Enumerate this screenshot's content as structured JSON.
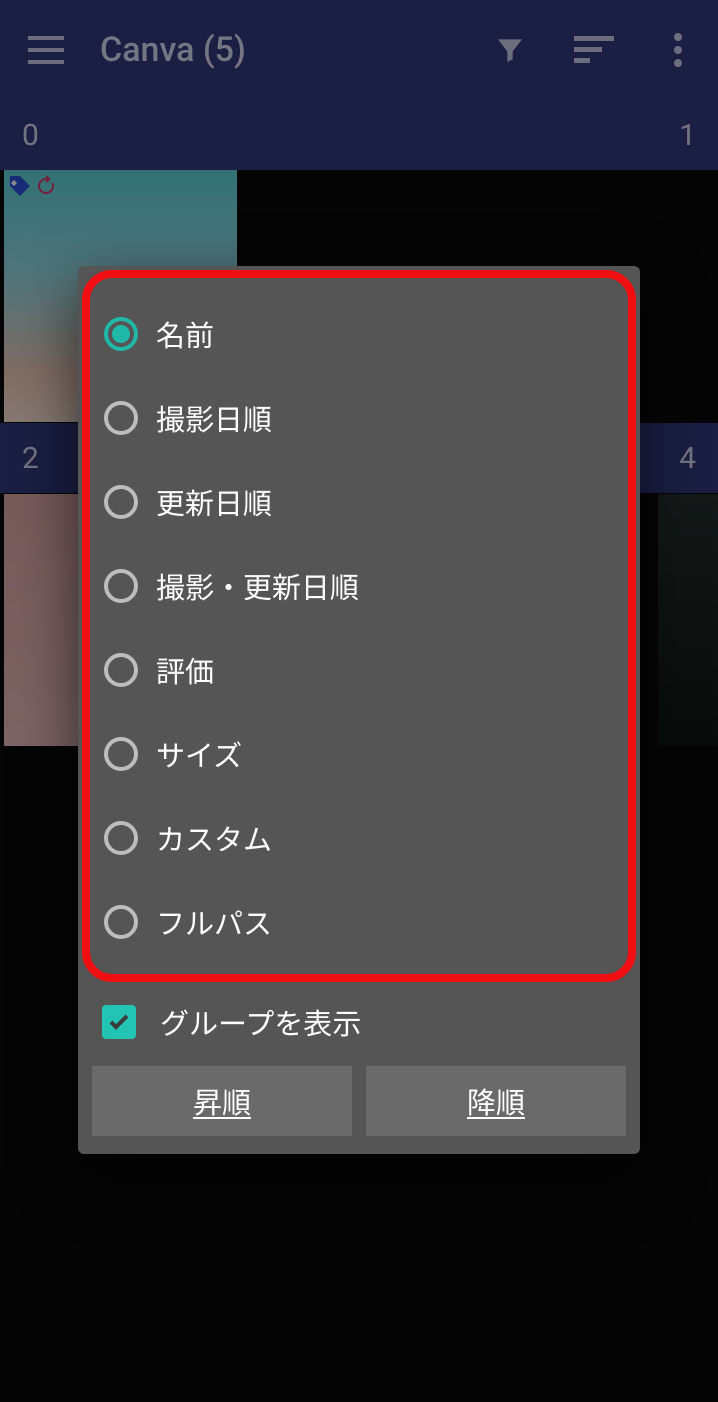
{
  "appbar": {
    "title": "Canva (5)"
  },
  "sections": {
    "header0_left": "0",
    "header0_right": "1",
    "header1_left": "2",
    "header1_right": "4"
  },
  "dialog": {
    "sort_options": [
      {
        "label": "名前",
        "selected": true
      },
      {
        "label": "撮影日順",
        "selected": false
      },
      {
        "label": "更新日順",
        "selected": false
      },
      {
        "label": "撮影・更新日順",
        "selected": false
      },
      {
        "label": "評価",
        "selected": false
      },
      {
        "label": "サイズ",
        "selected": false
      },
      {
        "label": "カスタム",
        "selected": false
      },
      {
        "label": "フルパス",
        "selected": false
      }
    ],
    "show_groups_label": "グループを表示",
    "show_groups_checked": true,
    "asc_label": "昇順",
    "desc_label": "降順"
  },
  "colors": {
    "accent": "#1fb8a9",
    "appbar_bg": "#303a7a",
    "dialog_bg": "#555555",
    "highlight": "#f10e12"
  }
}
